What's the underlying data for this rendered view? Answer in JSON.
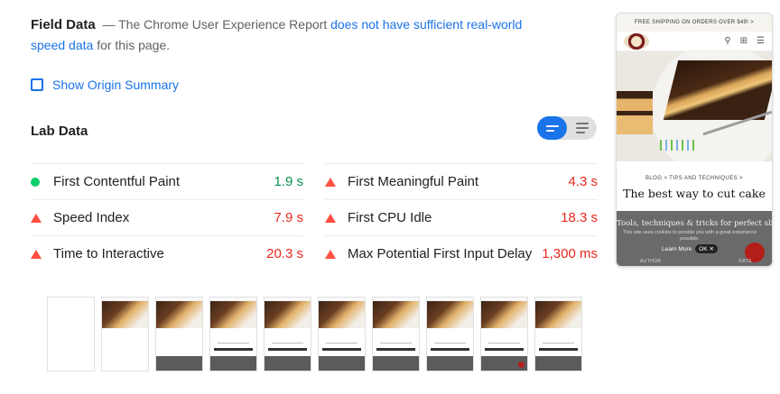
{
  "field_data": {
    "heading": "Field Data",
    "dash": "—",
    "text_before": "The Chrome User Experience Report",
    "link": "does not have sufficient real-world speed data",
    "text_after": "for this page."
  },
  "origin_summary": {
    "label": "Show Origin Summary",
    "checked": false
  },
  "lab": {
    "heading": "Lab Data",
    "view_toggle": "bar-view"
  },
  "metrics": [
    {
      "name": "First Contentful Paint",
      "value": "1.9 s",
      "status": "pass"
    },
    {
      "name": "First Meaningful Paint",
      "value": "4.3 s",
      "status": "fail"
    },
    {
      "name": "Speed Index",
      "value": "7.9 s",
      "status": "fail"
    },
    {
      "name": "First CPU Idle",
      "value": "18.3 s",
      "status": "fail"
    },
    {
      "name": "Time to Interactive",
      "value": "20.3 s",
      "status": "fail"
    },
    {
      "name": "Max Potential First Input Delay",
      "value": "1,300 ms",
      "status": "fail"
    }
  ],
  "colors": {
    "accent": "#1a73e8",
    "pass": "#0cce6b",
    "fail": "#ff4e42"
  },
  "filmstrip": {
    "frames": [
      {
        "state": "blank"
      },
      {
        "state": "hero"
      },
      {
        "state": "hero-bar"
      },
      {
        "state": "full"
      },
      {
        "state": "full"
      },
      {
        "state": "full"
      },
      {
        "state": "full"
      },
      {
        "state": "full"
      },
      {
        "state": "full-fab"
      },
      {
        "state": "full"
      }
    ]
  },
  "screenshot": {
    "banner": "FREE SHIPPING ON ORDERS OVER $49! >",
    "breadcrumb": "BLOG > TIPS AND TECHNIQUES >",
    "title": "The best way to cut cake",
    "tagline": "Tools, techniques & tricks for perfect slices",
    "cookie_text": "This site uses cookies to provide you with a great experience possible.",
    "learn_more": "Learn More",
    "close": "OK ✕",
    "author_label": "AUTHOR",
    "date_label": "DATE",
    "nav_icons": [
      "search-icon",
      "cart-icon",
      "menu-icon"
    ]
  }
}
